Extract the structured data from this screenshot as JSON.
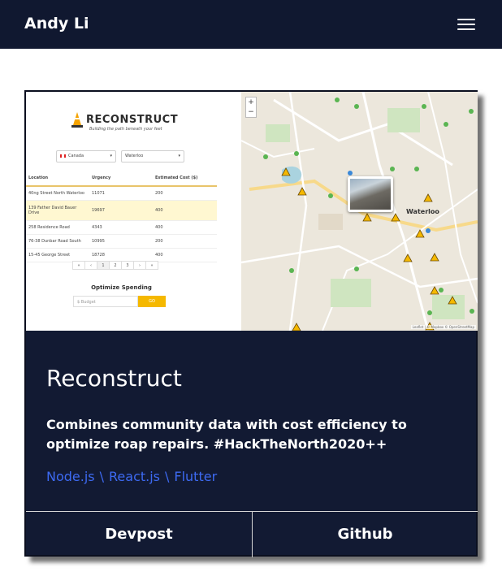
{
  "nav": {
    "brand": "Andy Li",
    "menu_icon": "hamburger-menu-icon"
  },
  "project": {
    "title": "Reconstruct",
    "description": "Combines community data with cost efficiency to optimize roap repairs. #HackTheNorth2020++",
    "tags": [
      "Node.js",
      "React.js",
      "Flutter"
    ],
    "tag_separator": "\\",
    "buttons": {
      "devpost": "Devpost",
      "github": "Github"
    },
    "tag_color": "#3d6af2",
    "card_color": "#121a33",
    "nav_color": "#101830"
  },
  "preview": {
    "app_title": "RECONSTRUCT",
    "tagline": "Building the path beneath your feet",
    "country": "Canada",
    "city_select": "Waterloo",
    "table": {
      "headers": [
        "Location",
        "Urgency",
        "Estimated Cost ($)"
      ],
      "rows": [
        [
          "40ng Street North Waterloo",
          "11071",
          "200"
        ],
        [
          "139 Father David Bauer Drive",
          "19697",
          "400"
        ],
        [
          "258 Residence Road",
          "4343",
          "400"
        ],
        [
          "76-38 Dunbar Road South",
          "10995",
          "200"
        ],
        [
          "15-45 George Street",
          "18728",
          "400"
        ]
      ]
    },
    "pager": [
      "«",
      "‹",
      "1",
      "2",
      "3",
      "›",
      "»"
    ],
    "optimize_title": "Optimize Spending",
    "budget_placeholder": "$  Budget",
    "go_label": "GO",
    "map_city": "Waterloo",
    "zoom_in": "+",
    "zoom_out": "−",
    "map_attribution": "Leaflet | © Mapbox © OpenStreetMap"
  }
}
